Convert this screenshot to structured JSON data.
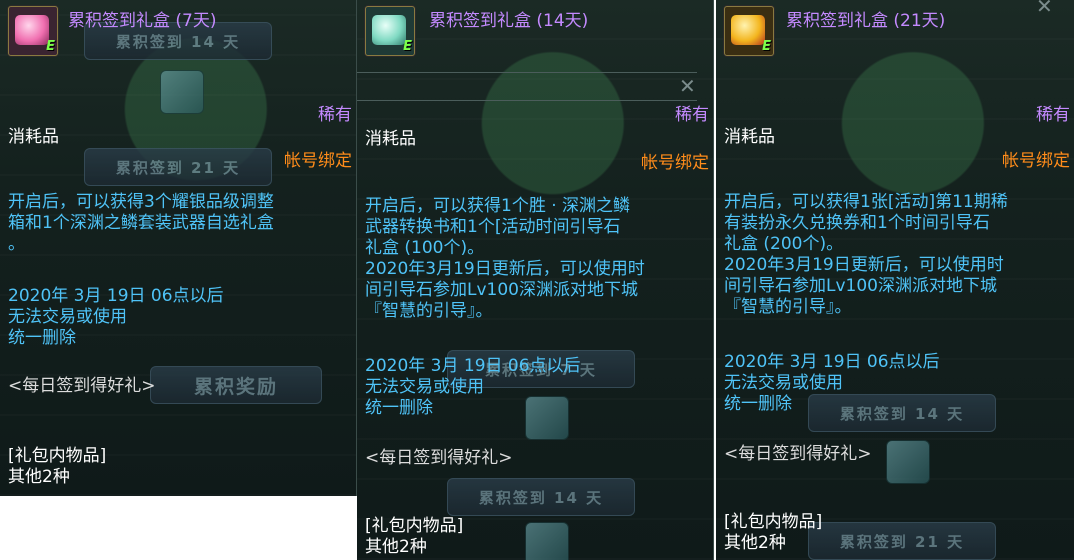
{
  "panels": [
    {
      "title": "累积签到礼盒 (7天)",
      "rarity": "稀有",
      "category": "消耗品",
      "binding": "帐号绑定",
      "description": [
        "开启后，可以获得3个耀银品级调整",
        "箱和1个深渊之鳞套装武器自选礼盒",
        "。"
      ],
      "expire": [
        "2020年 3月 19日 06点以后",
        "无法交易或使用",
        "统一删除"
      ],
      "source": "<每日签到得好礼>",
      "contents_header": "[礼包内物品]",
      "contents_value": "其他2种",
      "icon_color": "#f06fb0",
      "bg_buttons": [
        "累积签到 14 天",
        "累积签到 21 天",
        "累积奖励"
      ],
      "grade": "E"
    },
    {
      "title": "累积签到礼盒 (14天)",
      "rarity": "稀有",
      "category": "消耗品",
      "binding": "帐号绑定",
      "description": [
        "开启后，可以获得1个胜 · 深渊之鳞",
        "武器转换书和1个[活动时间引导石",
        "礼盒 (100个)。",
        "2020年3月19日更新后，可以使用时",
        "间引导石参加Lv100深渊派对地下城",
        "『智慧的引导』。"
      ],
      "expire": [
        "2020年 3月 19日 06点以后",
        "无法交易或使用",
        "统一删除"
      ],
      "source": "<每日签到得好礼>",
      "contents_header": "[礼包内物品]",
      "contents_value": "其他2种",
      "icon_color": "#7fd9c2",
      "bg_buttons": [
        "累积签到 7 天",
        "累积签到 14 天"
      ],
      "grade": "E"
    },
    {
      "title": "累积签到礼盒 (21天)",
      "rarity": "稀有",
      "category": "消耗品",
      "binding": "帐号绑定",
      "description": [
        "开启后，可以获得1张[活动]第11期稀",
        "有装扮永久兑换券和1个时间引导石",
        "礼盒 (200个)。",
        "2020年3月19日更新后，可以使用时",
        "间引导石参加Lv100深渊派对地下城",
        "『智慧的引导』。"
      ],
      "expire": [
        "2020年 3月 19日 06点以后",
        "无法交易或使用",
        "统一删除"
      ],
      "source": "<每日签到得好礼>",
      "contents_header": "[礼包内物品]",
      "contents_value": "其他2种",
      "icon_color": "#f3b51e",
      "bg_buttons": [
        "累积签到 14 天",
        "累积签到 21 天"
      ],
      "grade": "E"
    }
  ]
}
